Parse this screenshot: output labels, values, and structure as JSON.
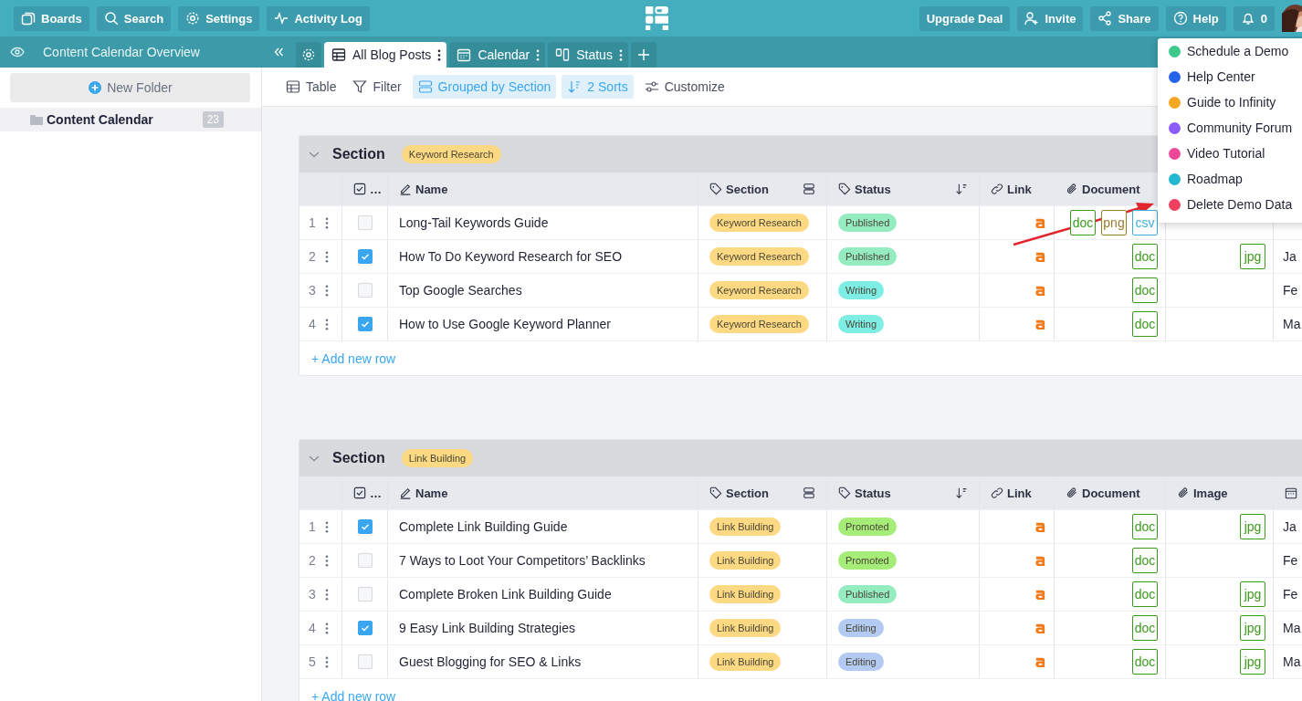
{
  "topbar": {
    "left_buttons": [
      {
        "label": "Boards"
      },
      {
        "label": "Search"
      },
      {
        "label": "Settings"
      },
      {
        "label": "Activity Log"
      }
    ],
    "right_buttons": [
      {
        "label": "Upgrade Deal"
      },
      {
        "label": "Invite"
      },
      {
        "label": "Share"
      },
      {
        "label": "Help"
      }
    ],
    "notifications": "0"
  },
  "sidebar": {
    "title": "Content Calendar Overview",
    "new_folder": "New Folder",
    "folders": [
      {
        "label": "Content Calendar",
        "count": "23",
        "selected": true
      }
    ]
  },
  "tabs": [
    {
      "label": "All Blog Posts",
      "selected": true
    },
    {
      "label": "Calendar",
      "selected": false
    },
    {
      "label": "Status",
      "selected": false
    }
  ],
  "toolbar": [
    {
      "label": "Table",
      "active": false
    },
    {
      "label": "Filter",
      "active": false
    },
    {
      "label": "Grouped by Section",
      "active": true
    },
    {
      "label": "2 Sorts",
      "active": true
    },
    {
      "label": "Customize",
      "active": false
    }
  ],
  "groups": [
    {
      "title": "Section",
      "tag": "Keyword Research",
      "add_row": "+ Add new row",
      "columns": [
        {
          "label": "…"
        },
        {
          "label": "Name"
        },
        {
          "label": "Section"
        },
        {
          "label": "Status"
        },
        {
          "label": "Link"
        },
        {
          "label": "Document"
        },
        {}
      ],
      "rows": [
        {
          "number": "1",
          "checked": false,
          "name": "Long-Tail Keywords Guide",
          "section": "Keyword Research",
          "status": {
            "label": "Published",
            "color": "#95ecc0"
          },
          "documents": [
            {
              "type": "doc",
              "color": "#3c9a1e"
            },
            {
              "type": "png",
              "color": "#9a7c2a"
            },
            {
              "type": "csv",
              "color": "#3ab0d8"
            }
          ],
          "images": []
        },
        {
          "number": "2",
          "checked": true,
          "name": "How To Do Keyword Research for SEO",
          "section": "Keyword Research",
          "status": {
            "label": "Published",
            "color": "#95ecc0"
          },
          "documents": [
            {
              "type": "doc",
              "color": "#3c9a1e"
            }
          ],
          "images": [
            {
              "type": "jpg",
              "color": "#3c9a1e"
            }
          ],
          "date": "Ja"
        },
        {
          "number": "3",
          "checked": false,
          "name": "Top Google Searches",
          "section": "Keyword Research",
          "status": {
            "label": "Writing",
            "color": "#7eeee4"
          },
          "documents": [
            {
              "type": "doc",
              "color": "#3c9a1e"
            }
          ],
          "images": [],
          "date": "Fe"
        },
        {
          "number": "4",
          "checked": true,
          "name": "How to Use Google Keyword Planner",
          "section": "Keyword Research",
          "status": {
            "label": "Writing",
            "color": "#7eeee4"
          },
          "documents": [
            {
              "type": "doc",
              "color": "#3c9a1e"
            }
          ],
          "images": [],
          "date": "Ma"
        }
      ]
    },
    {
      "title": "Section",
      "tag": "Link Building",
      "add_row": "+ Add new row",
      "columns": [
        {
          "label": "…"
        },
        {
          "label": "Name"
        },
        {
          "label": "Section"
        },
        {
          "label": "Status"
        },
        {
          "label": "Link"
        },
        {
          "label": "Document"
        },
        {
          "label": "Image"
        },
        {}
      ],
      "rows": [
        {
          "number": "1",
          "checked": true,
          "name": "Complete Link Building Guide",
          "section": "Link Building",
          "status": {
            "label": "Promoted",
            "color": "#a5ec79"
          },
          "documents": [
            {
              "type": "doc",
              "color": "#3c9a1e"
            }
          ],
          "images": [
            {
              "type": "jpg",
              "color": "#3c9a1e"
            }
          ],
          "date": "Ja"
        },
        {
          "number": "2",
          "checked": false,
          "name": "7 Ways to Loot Your Competitors’ Backlinks",
          "section": "Link Building",
          "status": {
            "label": "Promoted",
            "color": "#a5ec79"
          },
          "documents": [
            {
              "type": "doc",
              "color": "#3c9a1e"
            }
          ],
          "images": [],
          "date": "Fe"
        },
        {
          "number": "3",
          "checked": false,
          "name": "Complete Broken Link Building Guide",
          "section": "Link Building",
          "status": {
            "label": "Published",
            "color": "#95ecc0"
          },
          "documents": [
            {
              "type": "doc",
              "color": "#3c9a1e"
            }
          ],
          "images": [
            {
              "type": "jpg",
              "color": "#3c9a1e"
            }
          ],
          "date": "Fe"
        },
        {
          "number": "4",
          "checked": true,
          "name": "9 Easy Link Building Strategies",
          "section": "Link Building",
          "status": {
            "label": "Editing",
            "color": "#b3caf2"
          },
          "documents": [
            {
              "type": "doc",
              "color": "#3c9a1e"
            }
          ],
          "images": [
            {
              "type": "jpg",
              "color": "#3c9a1e"
            }
          ],
          "date": "Ma"
        },
        {
          "number": "5",
          "checked": false,
          "name": "Guest Blogging for SEO & Links",
          "section": "Link Building",
          "status": {
            "label": "Editing",
            "color": "#b3caf2"
          },
          "documents": [
            {
              "type": "doc",
              "color": "#3c9a1e"
            }
          ],
          "images": [
            {
              "type": "jpg",
              "color": "#3c9a1e"
            }
          ],
          "date": "Ma"
        }
      ]
    }
  ],
  "help_menu": [
    {
      "label": "Schedule a Demo",
      "color": "#3ec98c"
    },
    {
      "label": "Help Center",
      "color": "#2563eb"
    },
    {
      "label": "Guide to Infinity",
      "color": "#f5a623"
    },
    {
      "label": "Community Forum",
      "color": "#8b5cf6"
    },
    {
      "label": "Video Tutorial",
      "color": "#ec4899"
    },
    {
      "label": "Roadmap",
      "color": "#22b8cf"
    },
    {
      "label": "Delete Demo Data",
      "color": "#ef4060"
    }
  ]
}
